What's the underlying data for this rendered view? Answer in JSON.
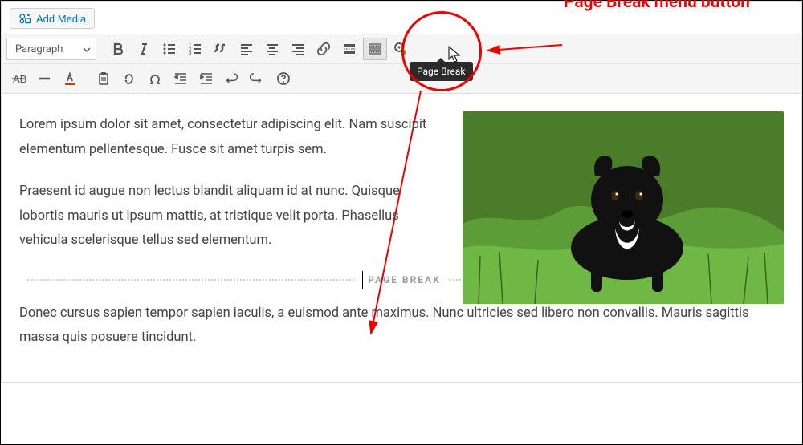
{
  "media_button_label": "Add Media",
  "format_select": "Paragraph",
  "tooltip": "Page Break",
  "annotation": "Page Break menu button",
  "page_break_label": "PAGE BREAK",
  "paragraphs": {
    "p1": "Lorem ipsum dolor sit amet, consectetur adipiscing elit. Nam suscipit elementum pellentesque. Fusce sit amet turpis sem.",
    "p2": "Praesent id augue non lectus blandit aliquam id at nunc. Quisque lobortis mauris ut ipsum mattis, at tristique velit porta. Phasellus vehicula scelerisque tellus sed elementum.",
    "p3": "Donec cursus sapien tempor sapien iaculis, a euismod ante maximus. Nunc ultricies sed libero non convallis. Mauris sagittis massa quis posuere tincidunt."
  },
  "toolbar_row1": [
    {
      "name": "bold-icon"
    },
    {
      "name": "italic-icon"
    },
    {
      "name": "bullet-list-icon"
    },
    {
      "name": "number-list-icon"
    },
    {
      "name": "blockquote-icon"
    },
    {
      "name": "align-left-icon"
    },
    {
      "name": "align-center-icon"
    },
    {
      "name": "align-right-icon"
    },
    {
      "name": "link-icon"
    },
    {
      "name": "read-more-icon"
    },
    {
      "name": "toolbar-toggle-icon"
    },
    {
      "name": "plugins-icon"
    }
  ],
  "toolbar_row2": [
    {
      "name": "strikethrough-icon"
    },
    {
      "name": "horizontal-rule-icon"
    },
    {
      "name": "text-color-icon"
    },
    {
      "name": "paste-icon"
    },
    {
      "name": "clear-formatting-icon"
    },
    {
      "name": "special-char-icon"
    },
    {
      "name": "outdent-icon"
    },
    {
      "name": "indent-icon"
    },
    {
      "name": "undo-icon"
    },
    {
      "name": "redo-icon"
    },
    {
      "name": "help-icon"
    }
  ]
}
